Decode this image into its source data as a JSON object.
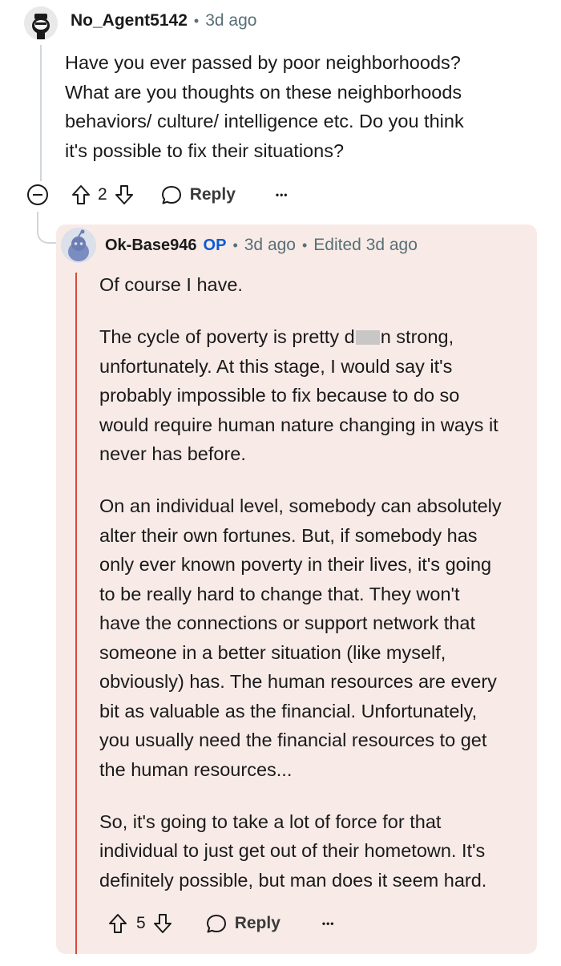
{
  "parent": {
    "username": "No_Agent5142",
    "time": "3d ago",
    "separator": "•",
    "body_lines": [
      "Have you ever passed by poor neighborhoods?",
      "What are you thoughts on these neighborhoods",
      "behaviors/ culture/ intelligence etc. Do you think",
      "it's possible to fix their situations?"
    ],
    "votes": "2",
    "reply_label": "Reply",
    "more_label": "•••"
  },
  "reply": {
    "username": "Ok-Base946",
    "op_badge": "OP",
    "time": "3d ago",
    "separator": "•",
    "edited": "Edited 3d ago",
    "p1": "Of course I have.",
    "p2_before": "The cycle of poverty is pretty d",
    "p2_after": "n strong,",
    "p2_lines": [
      "unfortunately. At this stage, I would say it's",
      "probably impossible to fix because to do so",
      "would require human nature changing in ways it",
      "never has before."
    ],
    "p3_lines": [
      "On an individual level, somebody can absolutely",
      "alter their own fortunes. But, if somebody has",
      "only ever known poverty in their lives, it's going",
      "to be really hard to change that. They won't",
      "have the connections or support network that",
      "someone in a better situation (like myself,",
      "obviously) has. The human resources are every",
      "bit as valuable as the financial. Unfortunately,",
      "you usually need the financial resources to get",
      "the human resources..."
    ],
    "p4_lines": [
      "So, it's going to take a lot of force for that",
      "individual to just get out of their hometown. It's",
      "definitely possible, but man does it seem hard."
    ],
    "votes": "5",
    "reply_label": "Reply",
    "more_label": "•••"
  },
  "colors": {
    "card_bg": "#f8ebe7",
    "op_blue": "#0a5ad3",
    "thread_red": "#d84a3c",
    "meta_gray": "#576f76"
  }
}
